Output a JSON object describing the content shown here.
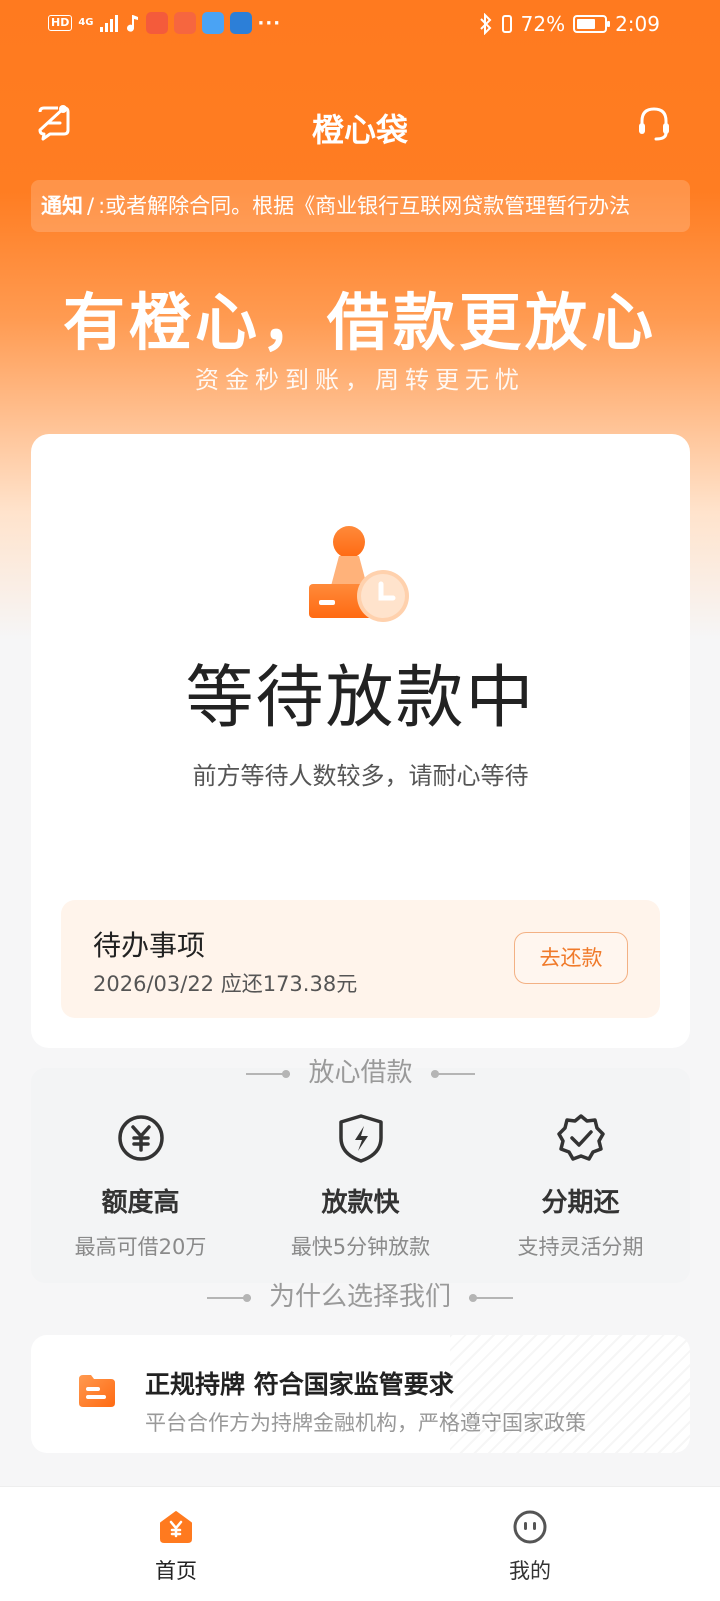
{
  "status_bar": {
    "network_hd": "HD",
    "network_4g": "4G",
    "battery_text": "72%",
    "battery_level": 0.72,
    "time": "2:09",
    "app_icons": [
      "app-icon-red",
      "app-icon-red",
      "app-icon-blue-book",
      "app-icon-blue"
    ]
  },
  "header": {
    "title": "橙心袋",
    "left_icon": "message-icon",
    "right_icon": "headset-icon"
  },
  "notice": {
    "label": "通知",
    "separator": "/",
    "text": ":或者解除合同。根据《商业银行互联网贷款管理暂行办法"
  },
  "hero": {
    "title": "有橙心，借款更放心",
    "subtitle": "资金秒到账，周转更无忧"
  },
  "loan_status": {
    "icon": "waiting-stamp-icon",
    "title": "等待放款中",
    "description": "前方等待人数较多，请耐心等待"
  },
  "todo": {
    "title": "待办事项",
    "detail": "2026/03/22 应还173.38元",
    "button_label": "去还款"
  },
  "features": {
    "heading": "放心借款",
    "items": [
      {
        "icon": "yuan-coin-icon",
        "title": "额度高",
        "desc": "最高可借20万"
      },
      {
        "icon": "lightning-shield-icon",
        "title": "放款快",
        "desc": "最快5分钟放款"
      },
      {
        "icon": "check-badge-icon",
        "title": "分期还",
        "desc": "支持灵活分期"
      }
    ]
  },
  "why": {
    "heading": "为什么选择我们",
    "card": {
      "icon": "license-icon",
      "title": "正规持牌 符合国家监管要求",
      "desc": "平台合作方为持牌金融机构，严格遵守国家政策"
    }
  },
  "tabbar": {
    "items": [
      {
        "label": "首页",
        "icon": "home-icon",
        "active": true
      },
      {
        "label": "我的",
        "icon": "profile-face-icon",
        "active": false
      }
    ]
  },
  "colors": {
    "brand_orange": "#ff7a1f",
    "tab_active": "#222222",
    "tab_inactive": "#333333"
  }
}
